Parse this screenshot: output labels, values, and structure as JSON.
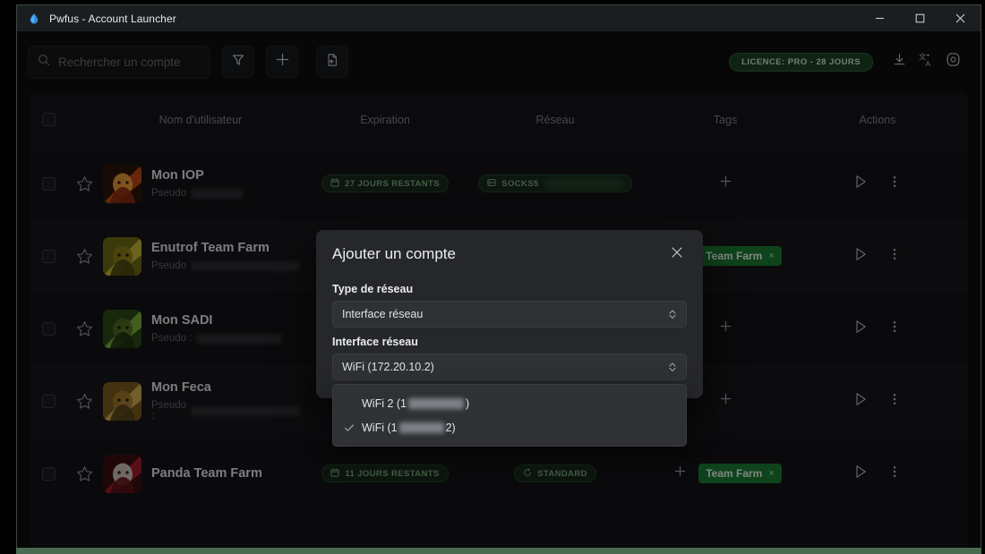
{
  "window": {
    "title": "Pwfus - Account Launcher",
    "app_icon": "droplet-icon",
    "controls": {
      "minimize": "minimize-icon",
      "maximize": "maximize-icon",
      "close": "close-icon"
    }
  },
  "toolbar": {
    "search": {
      "placeholder": "Rechercher un compte",
      "value": "",
      "icon": "search-icon"
    },
    "filter_icon": "filter-funnel-icon",
    "add_icon": "plus-icon",
    "import_icon": "file-import-icon",
    "license_badge": "LICENCE: PRO - 28 JOURS",
    "download_icon": "download-icon",
    "language_icon": "translate-icon",
    "settings_icon": "gear-icon"
  },
  "table": {
    "columns": [
      "",
      "",
      "Nom d'utilisateur",
      "Expiration",
      "Réseau",
      "Tags",
      "Actions"
    ],
    "header": {
      "select_all": "select-all-checkbox",
      "username": "Nom d'utilisateur",
      "expiration": "Expiration",
      "network": "Réseau",
      "tags": "Tags",
      "actions": "Actions"
    },
    "rows": [
      {
        "name": "Mon IOP",
        "pseudo_label": "Pseudo",
        "pseudo_redacted": true,
        "expiration": "27 JOURS RESTANTS",
        "network": "SOCKS5",
        "network_redacted": true,
        "tags": [],
        "avatar": "avatar-iop",
        "avatar_colors": [
          "#2a1508",
          "#c24a18",
          "#f2a33c",
          "#8b2b10"
        ]
      },
      {
        "name": "Enutrof Team Farm",
        "pseudo_label": "Pseudo",
        "pseudo_redacted": true,
        "expiration": "",
        "network": "",
        "network_redacted": false,
        "tags": [
          "Team Farm"
        ],
        "avatar": "avatar-enutrof",
        "avatar_colors": [
          "#6b6a14",
          "#c9b93a",
          "#8d7a1c",
          "#4a4410"
        ]
      },
      {
        "name": "Mon SADI",
        "pseudo_label": "Pseudo :",
        "pseudo_redacted": true,
        "expiration": "",
        "network": "",
        "network_redacted": false,
        "tags": [],
        "avatar": "avatar-sadi",
        "avatar_colors": [
          "#2d4a16",
          "#7fae3b",
          "#4c6b22",
          "#1f330f"
        ]
      },
      {
        "name": "Mon Feca",
        "pseudo_label": "Pseudo :",
        "pseudo_redacted": true,
        "expiration": "",
        "network": "",
        "network_redacted": false,
        "tags": [],
        "avatar": "avatar-feca",
        "avatar_colors": [
          "#7a5c1e",
          "#d8b056",
          "#a37a2c",
          "#52401a"
        ]
      },
      {
        "name": "Panda Team Farm",
        "pseudo_label": "",
        "pseudo_redacted": false,
        "expiration": "11 JOURS RESTANTS",
        "network": "STANDARD",
        "network_redacted": false,
        "tags": [
          "Team Farm"
        ],
        "avatar": "avatar-panda",
        "avatar_colors": [
          "#3a0d12",
          "#a51e2c",
          "#d9cfc4",
          "#5c1218"
        ]
      }
    ],
    "row_icons": {
      "favorite": "star-icon",
      "select": "row-checkbox",
      "launch": "play-triangle-icon",
      "more": "more-vertical-icon",
      "add_tag": "plus-icon",
      "tag_remove": "×",
      "expiration_icon": "calendar-clock-icon",
      "network_icon": "server-icon",
      "network_standard_icon": "refresh-icon"
    }
  },
  "modal": {
    "title": "Ajouter un compte",
    "close_icon": "close-icon",
    "fields": [
      {
        "label": "Type de réseau",
        "value": "Interface réseau",
        "name": "network-type-select"
      },
      {
        "label": "Interface réseau",
        "value": "WiFi (172.20.10.2)",
        "name": "network-interface-select"
      }
    ],
    "dropdown": {
      "open": true,
      "options": [
        {
          "prefix": "WiFi 2 (1",
          "redacted": true,
          "suffix": ")",
          "selected": false
        },
        {
          "prefix": "WiFi (1",
          "redacted": true,
          "suffix": "2)",
          "selected": true
        }
      ],
      "check_icon": "check-icon"
    }
  },
  "colors": {
    "accent_green": "#1b7a32",
    "badge_green_text": "#7ea782",
    "license_green_bg": "#1c4023",
    "window_bg": "#0d0d0f",
    "modal_bg": "#26272a",
    "bottom_strip": "#4a6b52"
  }
}
